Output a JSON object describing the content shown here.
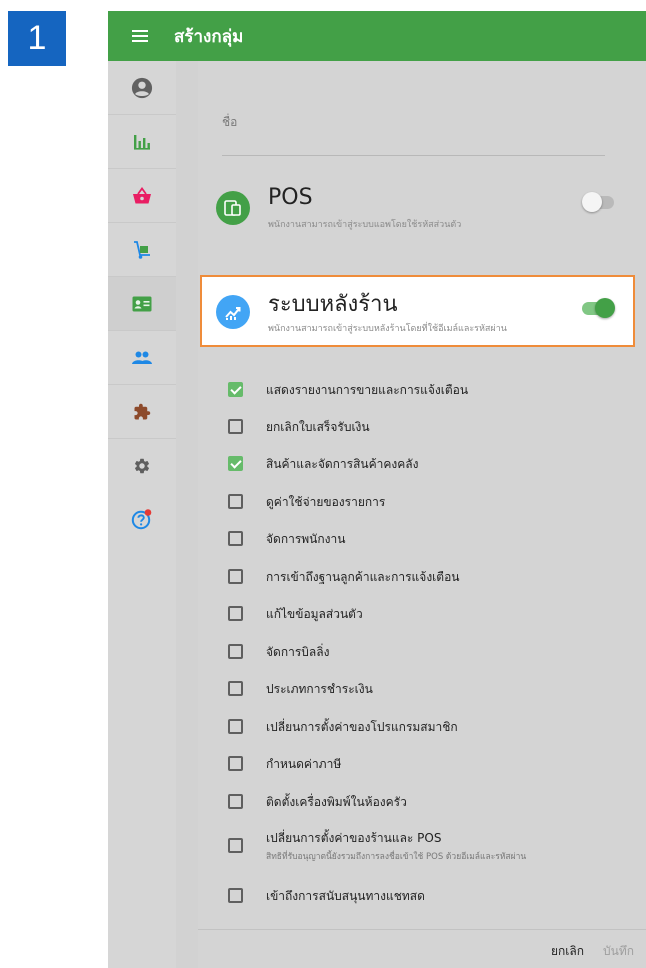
{
  "step_number": "1",
  "app": {
    "title": "สร้างกลุ่ม",
    "accent_color": "#43a047"
  },
  "sidebar": {
    "items": [
      {
        "icon": "account-circle-icon"
      },
      {
        "icon": "bar-chart-icon"
      },
      {
        "icon": "shopping-basket-icon"
      },
      {
        "icon": "hand-truck-icon"
      },
      {
        "icon": "employee-card-icon",
        "active": true
      },
      {
        "icon": "people-icon"
      },
      {
        "icon": "puzzle-icon"
      },
      {
        "icon": "gear-icon"
      },
      {
        "icon": "help-icon"
      }
    ]
  },
  "form": {
    "name_label": "ชื่อ"
  },
  "pos": {
    "title": "POS",
    "subtitle": "พนักงานสามารถเข้าสู่ระบบแอพโดยใช้รหัสส่วนตัว",
    "enabled": false,
    "icon_color": "#43a047"
  },
  "backoffice": {
    "title": "ระบบหลังร้าน",
    "subtitle": "พนักงานสามารถเข้าสู่ระบบหลังร้านโดยที่ใช้อีเมล์และรหัสผ่าน",
    "enabled": true,
    "icon_color": "#42a5f5",
    "highlight_color": "#ef8c3a"
  },
  "permissions": [
    {
      "label": "แสดงรายงานการขายและการแจ้งเตือน",
      "checked": true
    },
    {
      "label": "ยกเลิกใบเสร็จรับเงิน",
      "checked": false
    },
    {
      "label": "สินค้าและจัดการสินค้าคงคลัง",
      "checked": true
    },
    {
      "label": "ดูค่าใช้จ่ายของรายการ",
      "checked": false
    },
    {
      "label": "จัดการพนักงาน",
      "checked": false
    },
    {
      "label": "การเข้าถึงฐานลูกค้าและการแจ้งเตือน",
      "checked": false
    },
    {
      "label": "แก้ไขข้อมูลส่วนตัว",
      "checked": false
    },
    {
      "label": "จัดการบิลลิ่ง",
      "checked": false
    },
    {
      "label": "ประเภทการชำระเงิน",
      "checked": false
    },
    {
      "label": "เปลี่ยนการตั้งค่าของโปรแกรมสมาชิก",
      "checked": false
    },
    {
      "label": "กำหนดค่าภาษี",
      "checked": false
    },
    {
      "label": "ติดตั้งเครื่องพิมพ์ในห้องครัว",
      "checked": false
    },
    {
      "label": "เปลี่ยนการตั้งค่าของร้านและ POS",
      "sublabel": "สิทธิที่รับอนุญาตนี้ยังรวมถึงการลงชื่อเข้าใช้ POS ด้วยอีเมล์และรหัสผ่าน",
      "checked": false
    },
    {
      "label": "เข้าถึงการสนับสนุนทางแชทสด",
      "checked": false
    }
  ],
  "footer": {
    "cancel_label": "ยกเลิก",
    "save_label": "บันทึก"
  }
}
